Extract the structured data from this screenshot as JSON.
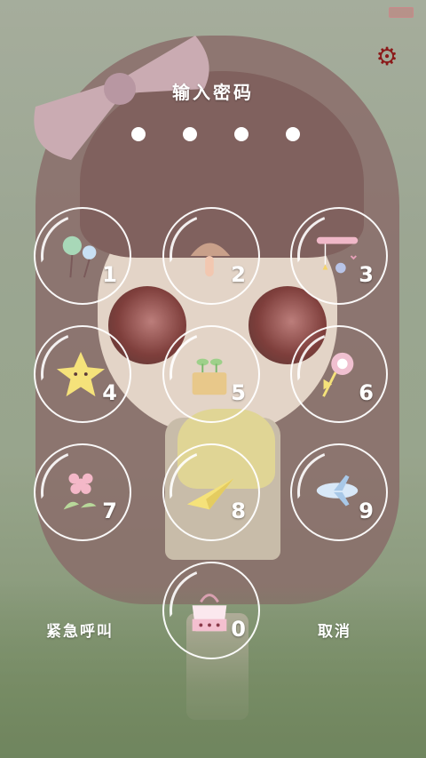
{
  "lock_screen": {
    "title": "输入密码",
    "pin_dots": 4,
    "keys": [
      {
        "num": "1",
        "icon": "balloons-icon"
      },
      {
        "num": "2",
        "icon": "mushroom-icon"
      },
      {
        "num": "3",
        "icon": "hanging-decor-icon"
      },
      {
        "num": "4",
        "icon": "star-face-icon"
      },
      {
        "num": "5",
        "icon": "sprout-pot-icon"
      },
      {
        "num": "6",
        "icon": "lollipop-icon"
      },
      {
        "num": "7",
        "icon": "flower-icon"
      },
      {
        "num": "8",
        "icon": "paper-plane-icon"
      },
      {
        "num": "9",
        "icon": "airplane-icon"
      },
      {
        "num": "0",
        "icon": "handbag-icon"
      }
    ],
    "emergency_call": "紧急呼叫",
    "cancel": "取消"
  },
  "colors": {
    "accent": "#8b1a1a",
    "key_ring": "#ffffff"
  }
}
